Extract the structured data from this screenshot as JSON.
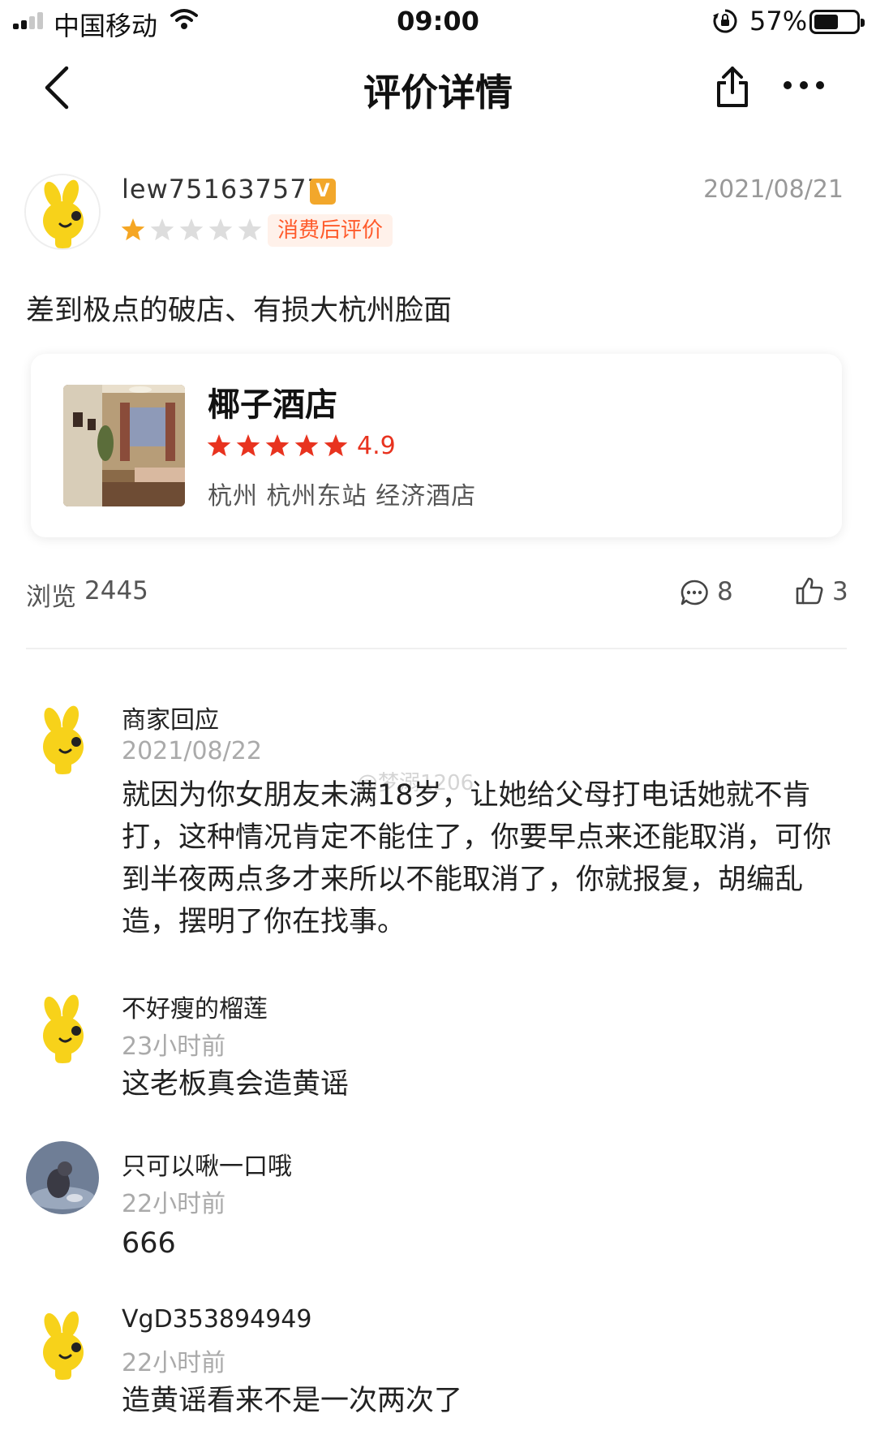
{
  "status_bar": {
    "carrier": "中国移动",
    "time": "09:00",
    "battery": "57%",
    "battery_level": 0.57
  },
  "nav": {
    "title": "评价详情"
  },
  "review": {
    "username": "lew751637577",
    "verified_badge": "V",
    "date": "2021/08/21",
    "stars": 1,
    "stars_max": 5,
    "tag": "消费后评价",
    "text": "差到极点的破店、有损大杭州脸面"
  },
  "hotel": {
    "name": "椰子酒店",
    "rating": "4.9",
    "stars": 5,
    "location": "杭州 杭州东站 经济酒店"
  },
  "stats": {
    "views_label": "浏览",
    "views": "2445",
    "comments": "8",
    "likes": "3"
  },
  "comments": [
    {
      "name": "商家回应",
      "time": "2021/08/22",
      "text": "就因为你女朋友未满18岁，让她给父母打电话她就不肯打，这种情况肯定不能住了，你要早点来还能取消，可你到半夜两点多才来所以不能取消了，你就报复，胡编乱造，摆明了你在找事。"
    },
    {
      "name": "不好瘦的榴莲",
      "time": "23小时前",
      "text": "这老板真会造黄谣"
    },
    {
      "name": "只可以啾一口哦",
      "time": "22小时前",
      "text": "666"
    },
    {
      "name": "VgD353894949",
      "time": "22小时前",
      "text": "造黄谣看来不是一次两次了"
    }
  ],
  "watermark": "@梦溺1206",
  "colors": {
    "star": "#f5a623",
    "star_empty": "#dddddd",
    "hotel_star": "#e8331f",
    "tag_text": "#ff5a2b",
    "tag_bg": "#fff1ea"
  }
}
